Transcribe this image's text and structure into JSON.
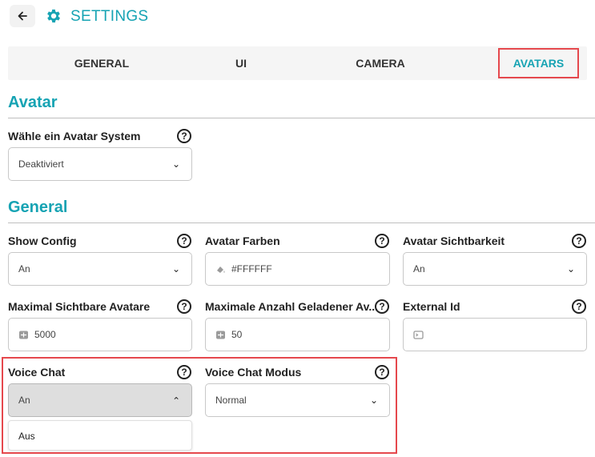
{
  "header": {
    "title": "SETTINGS"
  },
  "tabs": [
    {
      "label": "GENERAL",
      "active": false
    },
    {
      "label": "UI",
      "active": false
    },
    {
      "label": "CAMERA",
      "active": false
    },
    {
      "label": "AVATARS",
      "active": true
    }
  ],
  "sections": {
    "avatar": {
      "title": "Avatar"
    },
    "general": {
      "title": "General"
    }
  },
  "fields": {
    "avatar_system": {
      "label": "Wähle ein Avatar System",
      "value": "Deaktiviert"
    },
    "show_config": {
      "label": "Show Config",
      "value": "An"
    },
    "avatar_colors": {
      "label": "Avatar Farben",
      "value": "#FFFFFF"
    },
    "avatar_visibility": {
      "label": "Avatar Sichtbarkeit",
      "value": "An"
    },
    "max_visible": {
      "label": "Maximal Sichtbare Avatare",
      "value": "5000"
    },
    "max_loaded": {
      "label": "Maximale Anzahl Geladener Av...",
      "value": "50"
    },
    "external_id": {
      "label": "External Id",
      "value": ""
    },
    "voice_chat": {
      "label": "Voice Chat",
      "value": "An",
      "options": [
        "Aus"
      ]
    },
    "voice_chat_mode": {
      "label": "Voice Chat Modus",
      "value": "Normal"
    }
  },
  "icons": {
    "back": "arrow-left-icon",
    "settings": "gear-icon",
    "help": "question-circle-icon",
    "dropdown": "chevron-down-icon",
    "color": "paint-bucket-icon",
    "number": "calculator-icon",
    "text": "terminal-icon"
  },
  "colors": {
    "accent": "#16a3b3",
    "highlight": "#e5484d"
  }
}
